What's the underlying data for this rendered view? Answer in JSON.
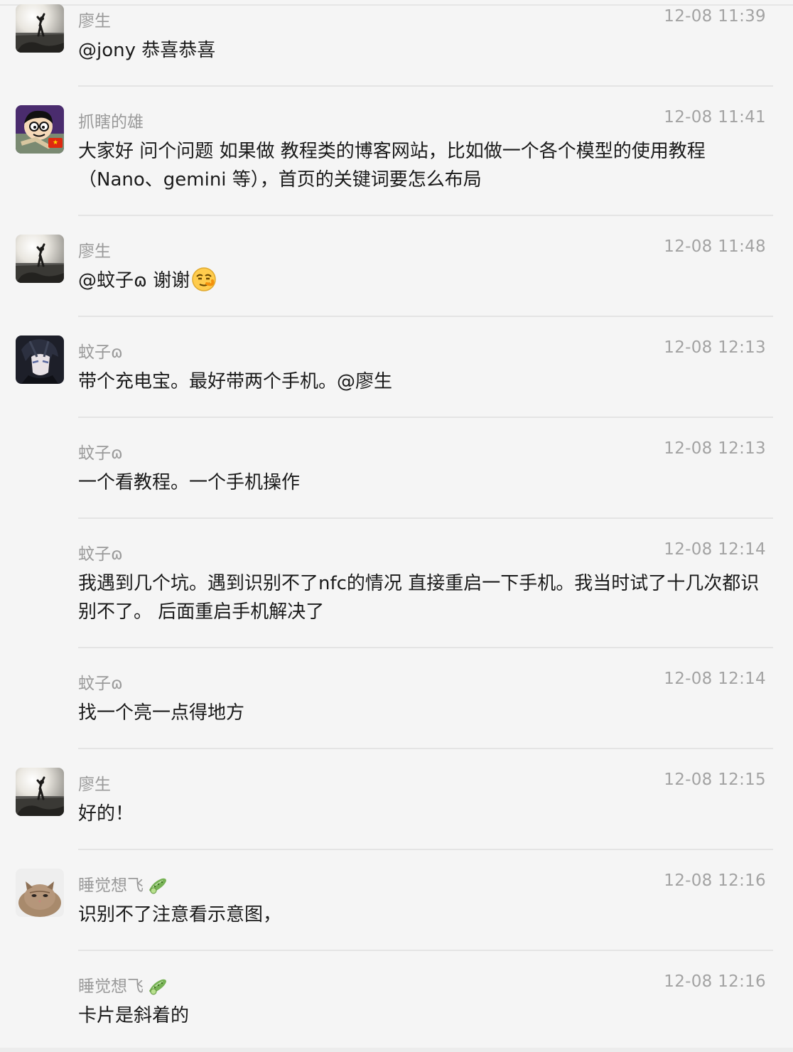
{
  "messages": [
    {
      "name": "廖生",
      "time": "12-08 11:39",
      "text": "@jony 恭喜恭喜",
      "avatar": "liao-avatar",
      "showAvatar": true
    },
    {
      "name": "抓瞎的雄",
      "time": "12-08 11:41",
      "text": "大家好 问个问题 如果做 教程类的博客网站，比如做一个各个模型的使用教程（Nano、gemini 等），首页的关键词要怎么布局",
      "avatar": "cartoon-avatar",
      "showAvatar": true,
      "flag": "★"
    },
    {
      "name": "廖生",
      "time": "12-08 11:48",
      "text": "@蚊子ɷ 谢谢",
      "avatar": "liao-avatar",
      "showAvatar": true,
      "emoji": "smirk-emoji"
    },
    {
      "name": "蚊子ɷ",
      "time": "12-08 12:13",
      "text": "带个充电宝。最好带两个手机。@廖生",
      "avatar": "anime-avatar",
      "showAvatar": true
    },
    {
      "name": "蚊子ɷ",
      "time": "12-08 12:13",
      "text": "一个看教程。一个手机操作",
      "showAvatar": false
    },
    {
      "name": "蚊子ɷ",
      "time": "12-08 12:14",
      "text": "我遇到几个坑。遇到识别不了nfc的情况 直接重启一下手机。我当时试了十几次都识别不了。 后面重启手机解决了",
      "showAvatar": false
    },
    {
      "name": "蚊子ɷ",
      "time": "12-08 12:14",
      "text": "找一个亮一点得地方",
      "showAvatar": false
    },
    {
      "name": "廖生",
      "time": "12-08 12:15",
      "text": "好的！",
      "avatar": "liao-avatar",
      "showAvatar": true
    },
    {
      "name": "睡觉想飞",
      "time": "12-08 12:16",
      "text": "识别不了注意看示意图，",
      "avatar": "cat-avatar",
      "showAvatar": true,
      "badge": "cucumber-icon"
    },
    {
      "name": "睡觉想飞",
      "time": "12-08 12:16",
      "text": "卡片是斜着的",
      "showAvatar": false,
      "badge": "cucumber-icon"
    }
  ],
  "colors": {
    "background": "#f5f5f5",
    "name": "#9a9a9a",
    "time": "#a3a3a3",
    "text": "#1a1a1a",
    "divider": "#e4e4e4"
  }
}
